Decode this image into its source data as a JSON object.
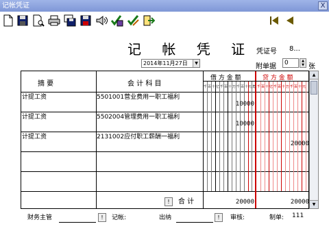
{
  "window": {
    "title": "记帐凭证",
    "close_label": "X"
  },
  "toolbar": {
    "buttons": [
      {
        "name": "new-file-icon"
      },
      {
        "name": "save-icon"
      },
      {
        "name": "print-preview-icon"
      },
      {
        "name": "printer-icon"
      },
      {
        "name": "save-as-icon"
      },
      {
        "name": "save-disk-icon"
      },
      {
        "name": "audio-icon"
      },
      {
        "name": "check-approve-icon"
      },
      {
        "name": "edit-check-icon"
      },
      {
        "name": "exit-icon"
      },
      {
        "name": "first-record-icon"
      },
      {
        "name": "previous-record-icon"
      }
    ]
  },
  "header": {
    "title": "记 帐 凭 证",
    "voucher_label": "凭证号",
    "voucher_value": "8...",
    "date_value": "2014年11月27日",
    "attach_label": "附单据",
    "attach_value": "0",
    "attach_unit": "张"
  },
  "table": {
    "col_summary": "摘    要",
    "col_account": "会  计  科  目",
    "col_debit": "借 方 金 额",
    "col_credit": "贷 方 金 额",
    "digit_labels": [
      "千",
      "百",
      "十",
      "亿",
      "千",
      "百",
      "十",
      "万",
      "千",
      "百",
      "十",
      "元",
      "角",
      "分"
    ],
    "rows": [
      {
        "summary": "计提工资",
        "account": "5501001营业费用一职工福利",
        "debit": "10000",
        "credit": ""
      },
      {
        "summary": "计提工资",
        "account": "5502004管理费用一职工福利",
        "debit": "10000",
        "credit": ""
      },
      {
        "summary": "计提工资",
        "account": "2131002应付职工薪酬一福利",
        "debit": "",
        "credit": "20000"
      },
      {
        "summary": "",
        "account": "",
        "debit": "",
        "credit": ""
      },
      {
        "summary": "",
        "account": "",
        "debit": "",
        "credit": ""
      }
    ],
    "total_label": "合 计",
    "total_debit": "20000",
    "total_credit": "20000",
    "mini_btn": "!"
  },
  "footer": {
    "supervisor_label": "财务主管",
    "bookkeeper_label": "记帐:",
    "cashier_label": "出纳",
    "reviewer_label": "审核:",
    "maker_label": "制单:",
    "maker_value": "111",
    "mini_btn": "!"
  },
  "colors": {
    "debit_lines": "#000000",
    "credit_lines": "#cc0000",
    "credit_header": "#cc0000",
    "titlebar": "#8aa1dd"
  }
}
